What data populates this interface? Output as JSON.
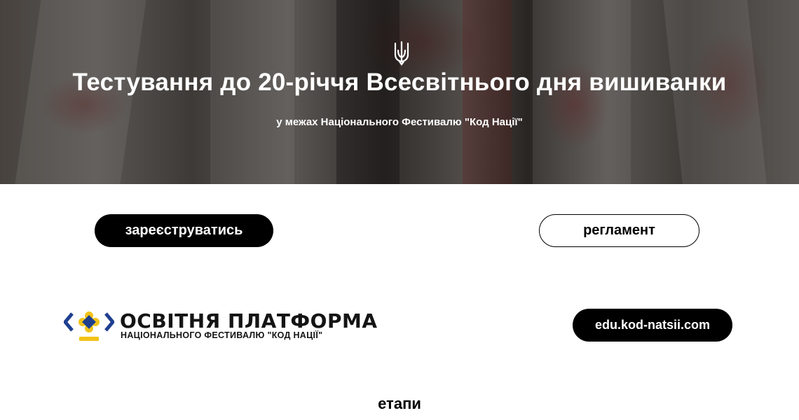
{
  "hero": {
    "title": "Тестування до 20-річчя Всесвітнього дня вишиванки",
    "subtitle": "у межах Національного Фестивалю \"Код Нації\""
  },
  "actions": {
    "register_label": "зареєструватись",
    "rules_label": "регламент"
  },
  "platform": {
    "logo_title": "ОСВІТНЯ ПЛАТФОРМА",
    "logo_subtitle": "НАЦІОНАЛЬНОГО ФЕСТИВАЛЮ \"КОД НАЦІЇ\"",
    "site_label": "edu.kod-natsii.com"
  },
  "stages": {
    "heading": "етапи"
  },
  "colors": {
    "primary": "#000000",
    "logo_blue": "#1f3f8f",
    "logo_yellow": "#f2c318"
  },
  "icons": {
    "hero": "trident-icon",
    "logo": "kod-natsii-logo-mark"
  }
}
